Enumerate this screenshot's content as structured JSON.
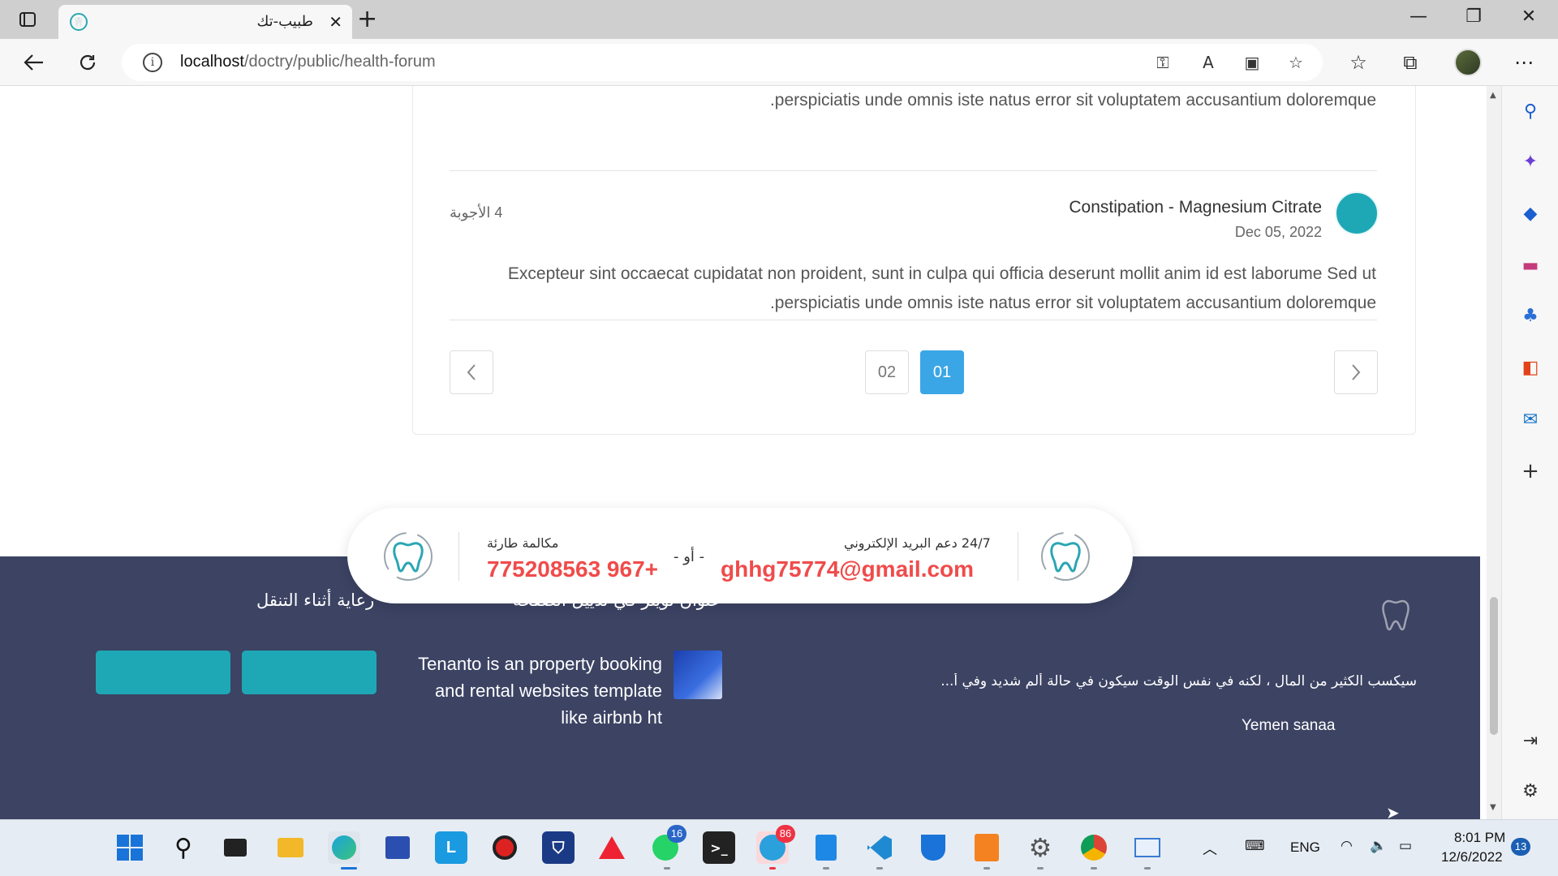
{
  "browser": {
    "tab_title": "طبيب-تك",
    "url_host": "localhost",
    "url_path": "/doctry/public/health-forum"
  },
  "forum": {
    "prev_post_tail": ".perspiciatis unde omnis iste natus error sit voluptatem accusantium doloremque",
    "post": {
      "title": "Constipation - Magnesium Citrate",
      "date": "Dec 05, 2022",
      "answers": "4 الأجوبة",
      "body_line1": "Excepteur sint occaecat cupidatat non proident, sunt in culpa qui officia deserunt mollit anim id est laborume Sed ut",
      "body_line2": ".perspiciatis unde omnis iste natus error sit voluptatem accusantium doloremque"
    },
    "pagination": {
      "pages": [
        "02",
        "01"
      ],
      "active": "01"
    }
  },
  "contact": {
    "email_label": "24/7 دعم البريد الإلكتروني",
    "email": "ghhg75774@gmail.com",
    "or": "- أو -",
    "phone_label": "مكالمة طارئة",
    "phone": "775208563 967+"
  },
  "footer": {
    "col_twitter_title": "عنوان تويتر في تذييل الصفحة",
    "col_nav_title": "رعاية أثناء التنقل",
    "tweet_line1": "Tenanto is an property booking",
    "tweet_line2": "and rental websites template",
    "tweet_line3": "like airbnb ht",
    "description": "سيكسب الكثير من المال ، لكنه في نفس الوقت سيكون في حالة ألم شديد وفي أ...",
    "location": "Yemen sanaa"
  },
  "taskbar": {
    "whatsapp_badge": "16",
    "telegram_badge": "86",
    "lang": "ENG",
    "time": "8:01 PM",
    "date": "12/6/2022",
    "notif_count": "13"
  },
  "colors": {
    "accent_teal": "#1ea8b6",
    "page_active_blue": "#3ba6e6",
    "footer_bg": "#3c4363",
    "contact_red": "#f04b4b"
  }
}
